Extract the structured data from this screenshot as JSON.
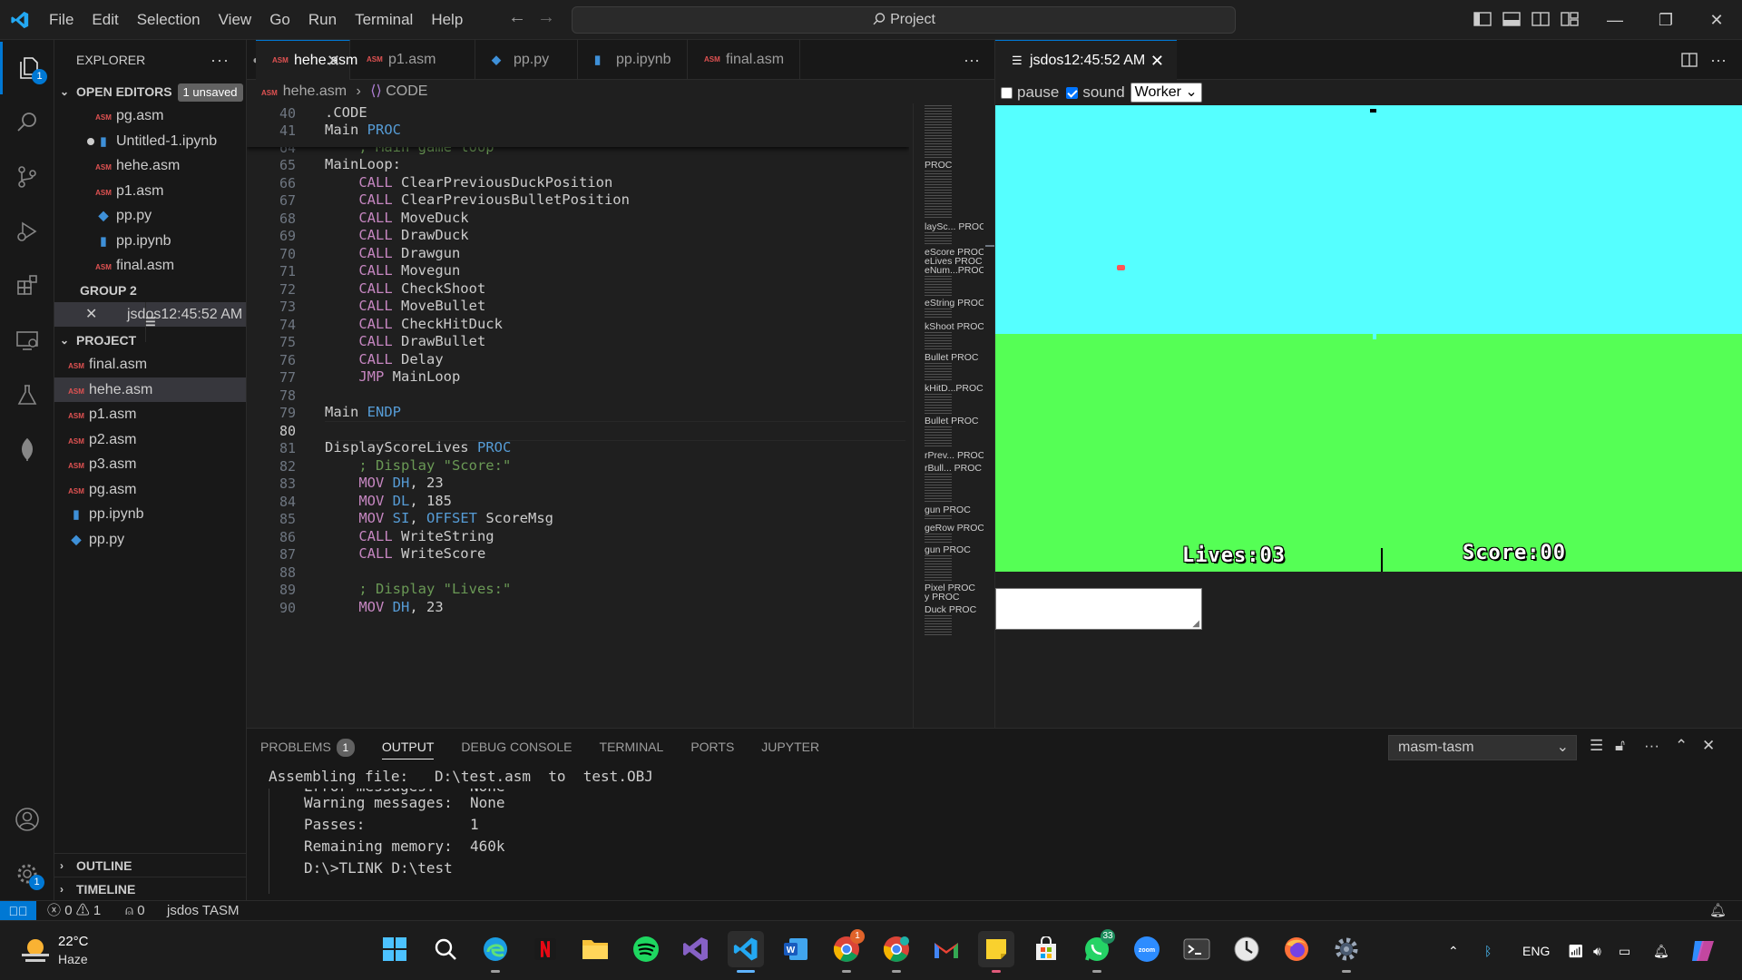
{
  "titlebar": {
    "menus": [
      "File",
      "Edit",
      "Selection",
      "View",
      "Go",
      "Run",
      "Terminal",
      "Help"
    ],
    "search": "Project"
  },
  "activity": {
    "explorer_badge": "1",
    "settings_badge": "1"
  },
  "sidebar": {
    "title": "EXPLORER",
    "open_editors_label": "OPEN EDITORS",
    "unsaved_label": "1 unsaved",
    "open_editors": [
      {
        "name": "pg.asm",
        "type": "asm"
      },
      {
        "name": "Untitled-1.ipynb",
        "type": "nb"
      },
      {
        "name": "hehe.asm",
        "type": "asm"
      },
      {
        "name": "p1.asm",
        "type": "asm"
      },
      {
        "name": "pp.py",
        "type": "py"
      },
      {
        "name": "pp.ipynb",
        "type": "nb"
      },
      {
        "name": "final.asm",
        "type": "asm"
      }
    ],
    "group2_label": "GROUP 2",
    "group2_item": "jsdos12:45:52 AM",
    "project_label": "PROJECT",
    "project_files": [
      {
        "name": "final.asm",
        "type": "asm"
      },
      {
        "name": "hehe.asm",
        "type": "asm"
      },
      {
        "name": "p1.asm",
        "type": "asm"
      },
      {
        "name": "p2.asm",
        "type": "asm"
      },
      {
        "name": "p3.asm",
        "type": "asm"
      },
      {
        "name": "pg.asm",
        "type": "asm"
      },
      {
        "name": "pp.ipynb",
        "type": "nb"
      },
      {
        "name": "pp.py",
        "type": "py"
      }
    ],
    "outline_label": "OUTLINE",
    "timeline_label": "TIMELINE"
  },
  "editor": {
    "tabs": [
      "hehe.asm",
      "p1.asm",
      "pp.py",
      "pp.ipynb",
      "final.asm"
    ],
    "breadcrumb_file": "hehe.asm",
    "breadcrumb_symbol": "CODE",
    "sticky": [
      {
        "n": "40",
        "text": ".CODE"
      },
      {
        "n": "41",
        "text": "Main PROC"
      }
    ],
    "partial_line": {
      "n": "64",
      "text": "    ; Main game loop"
    },
    "lines": [
      {
        "n": "65",
        "text": "MainLoop:"
      },
      {
        "n": "66",
        "text": "    CALL ClearPreviousDuckPosition"
      },
      {
        "n": "67",
        "text": "    CALL ClearPreviousBulletPosition"
      },
      {
        "n": "68",
        "text": "    CALL MoveDuck"
      },
      {
        "n": "69",
        "text": "    CALL DrawDuck"
      },
      {
        "n": "70",
        "text": "    CALL Drawgun"
      },
      {
        "n": "71",
        "text": "    CALL Movegun"
      },
      {
        "n": "72",
        "text": "    CALL CheckShoot"
      },
      {
        "n": "73",
        "text": "    CALL MoveBullet"
      },
      {
        "n": "74",
        "text": "    CALL CheckHitDuck"
      },
      {
        "n": "75",
        "text": "    CALL DrawBullet"
      },
      {
        "n": "76",
        "text": "    CALL Delay"
      },
      {
        "n": "77",
        "text": "    JMP MainLoop"
      },
      {
        "n": "78",
        "text": ""
      },
      {
        "n": "79",
        "text": "Main ENDP"
      },
      {
        "n": "80",
        "text": ""
      },
      {
        "n": "81",
        "text": "DisplayScoreLives PROC"
      },
      {
        "n": "82",
        "text": "    ; Display \"Score:\""
      },
      {
        "n": "83",
        "text": "    MOV DH, 23"
      },
      {
        "n": "84",
        "text": "    MOV DL, 185"
      },
      {
        "n": "85",
        "text": "    MOV SI, OFFSET ScoreMsg"
      },
      {
        "n": "86",
        "text": "    CALL WriteString"
      },
      {
        "n": "87",
        "text": "    CALL WriteScore"
      },
      {
        "n": "88",
        "text": ""
      },
      {
        "n": "89",
        "text": "    ; Display \"Lives:\""
      },
      {
        "n": "90",
        "text": "    MOV DH, 23"
      }
    ],
    "minimap_labels": [
      "PROC",
      "laySc... PROC",
      "eScore PROC",
      "eLives PROC",
      "eNum...PROC",
      "eString PROC",
      "kShoot PROC",
      "Bullet PROC",
      "kHitD...PROC",
      "Bullet PROC",
      "rPrev... PROC",
      "rBull... PROC",
      "gun PROC",
      "geRow PROC",
      "gun PROC",
      "Pixel PROC",
      "y PROC",
      "Duck PROC"
    ]
  },
  "jsdos": {
    "tab": "jsdos12:45:52 AM",
    "pause_label": "pause",
    "sound_label": "sound",
    "worker_value": "Worker",
    "lives_text": "Lives:03",
    "score_text": "Score:00"
  },
  "panel": {
    "tabs": [
      "PROBLEMS",
      "OUTPUT",
      "DEBUG CONSOLE",
      "TERMINAL",
      "PORTS",
      "JUPYTER"
    ],
    "problems_count": "1",
    "channel": "masm-tasm",
    "header_line": "Assembling file:   D:\\test.asm  to  test.OBJ",
    "partial_line": "Error messages:    None",
    "output_lines": [
      "Warning messages:  None",
      "Passes:            1",
      "Remaining memory:  460k",
      "D:\\>TLINK D:\\test"
    ]
  },
  "statusbar": {
    "errors": "0",
    "warnings": "1",
    "ports": "0",
    "mode": "jsdos TASM"
  },
  "taskbar": {
    "temp": "22°C",
    "weather": "Haze",
    "chrome_badge": "1",
    "whatsapp_badge": "33",
    "lang": "ENG"
  },
  "colors": {
    "accent": "#0078d4",
    "dos_sky": "#55ffff",
    "dos_grass": "#55ff55",
    "keyword": "#569cd6",
    "instruction": "#c586c0",
    "comment": "#6a9955"
  }
}
